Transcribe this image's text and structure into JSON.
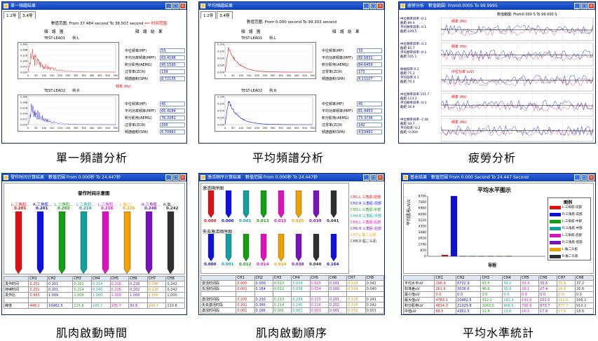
{
  "panels": [
    {
      "id": "single",
      "title": "單一頻譜結果",
      "tabs": [
        "1.2导",
        "3.4导"
      ],
      "range": "數值范圍: From 37.484 second To 38.507 second",
      "range_note": "时间范围",
      "header_left": "頻　譜　圖",
      "header_right": "頻　譜　結　果",
      "plot1_title": "TEST-LEAD1　　例:L",
      "plot2_title": "TEST-LEAD2　　例:R",
      "axis_label": "頻率 (Hz)",
      "y1_ticks": [
        "0.360",
        "0.288",
        "0.216",
        "0.144",
        "0.072",
        "0.000"
      ],
      "y2_ticks": [
        "0.360",
        "0.288",
        "0.216",
        "0.144",
        "0.072",
        "0.000"
      ],
      "x_ticks": [
        "0",
        "50",
        "100",
        "150",
        "200",
        "250",
        "300",
        "350",
        "400",
        "450",
        "500",
        "550"
      ],
      "params1": [
        {
          "label": "中位频率(MF)",
          "value": "53"
        },
        {
          "label": "平均功率頻率(MPF)",
          "value": "63.4196"
        },
        {
          "label": "积分肌电(AEMG)",
          "value": "95.1590"
        },
        {
          "label": "过零率(ZCR)",
          "value": "139"
        },
        {
          "label": "頻譜面积(SPA)",
          "value": "8.72135"
        }
      ],
      "params2": [
        {
          "label": "中位频率(MF)",
          "value": "45"
        },
        {
          "label": "平均功率頻率(MPF)",
          "value": "65.4184"
        },
        {
          "label": "积分肌电(AEMG)",
          "value": "76.2081"
        },
        {
          "label": "过零率(ZCR)",
          "value": "166"
        },
        {
          "label": "頻譜面积(SPA)",
          "value": "6.70991"
        }
      ],
      "caption": "單一頻譜分析"
    },
    {
      "id": "average",
      "title": "平均頻譜結果",
      "tabs": [
        "1.2导",
        "3.4导"
      ],
      "range": "數值范圍: From 0.000 second To 99.303 second",
      "header_left": "頻　譜　圖",
      "header_right": "頻　譜　結　果",
      "plot1_title": "TEST-LEAD1　　例:L",
      "plot2_title": "TEST-LEAD2　　例:R",
      "y1_ticks": [
        "0.140",
        "0.105",
        "0.070",
        "0.035",
        "0.000"
      ],
      "y2_ticks": [
        "0.140",
        "0.105",
        "0.070",
        "0.035",
        "0.000"
      ],
      "x_ticks": [
        "0",
        "50",
        "100",
        "150",
        "200",
        "250",
        "300",
        "350",
        "400",
        "450",
        "500",
        "550"
      ],
      "params1": [
        {
          "label": "中位频率(MF)",
          "value": "33"
        },
        {
          "label": "平均功率頻率(MPF)",
          "value": "82.5831"
        },
        {
          "label": "积分肌电(AEMG)",
          "value": "84.6459"
        },
        {
          "label": "过零率(ZCR)",
          "value": "173"
        },
        {
          "label": "頻譜面积(SPA)",
          "value": "8.11107"
        }
      ],
      "params2": [
        {
          "label": "中位频率(MF)",
          "value": "45"
        },
        {
          "label": "平均功率頻率(MPF)",
          "value": "81.4453"
        },
        {
          "label": "积分肌电(AEMG)",
          "value": "73.3736"
        },
        {
          "label": "过零率(ZCR)",
          "value": "142"
        },
        {
          "label": "頻譜面积(SPA)",
          "value": "4.53491"
        }
      ],
      "caption": "平均頻譜分析"
    },
    {
      "id": "fatigue",
      "title": "疲勞分析",
      "range": "數值範圍: From0.0005 To 99.9995",
      "range2": "數值範圍: From0.000 S To 99.000 S",
      "rows": [
        {
          "name": "頻率 (Hz)",
          "stats": [
            "中位頻率斜率:-0.2",
            "截距:89.4",
            "平均頻率斜率:-0.1",
            "截距:109.5"
          ]
        },
        {
          "name": "頻率 (Hz)",
          "stats": [
            "中位頻率斜率:-0.3",
            "截距:85.7",
            "平均頻率斜率:-0.2",
            "截距:105.1"
          ]
        },
        {
          "name": "中位功率 (uV)",
          "stats": [
            "振幅斜率:0.2",
            "截距:75.3",
            "平均斜率:0.1",
            "截距:70.3"
          ]
        },
        {
          "name": "頻率 (Hz)",
          "stats": [
            "中位頻率斜率:151.7",
            "截距:113.3",
            "平均頻率斜率:-0.3",
            "截距:36.9"
          ]
        },
        {
          "name": "頻率 (Hz)",
          "stats": [
            "中位頻率斜率:-7.46",
            "截距:40.7",
            "平均斜率:-0.2",
            "截距:-0.004"
          ]
        }
      ],
      "caption": "疲勞分析"
    },
    {
      "id": "onset",
      "title": "發作时间计算結果　數值范围 From 0.000秒 To 24.447秒",
      "chart_title": "發作时间示意图",
      "channels": [
        {
          "name": "L:三角肌...",
          "value": "0.201",
          "color": "#e01010"
        },
        {
          "name": "R:三角肌...",
          "value": "0.201",
          "color": "#1010e0"
        },
        {
          "name": "L:三角肌...",
          "value": "0.202",
          "color": "#10a010"
        },
        {
          "name": "L:三角肌...",
          "value": "0.214",
          "color": "#10a0a0"
        },
        {
          "name": "L:三角肌...",
          "value": "0.216",
          "color": "#e010c0"
        },
        {
          "name": "L:肱二...",
          "value": "0.226",
          "color": "#f0a000"
        },
        {
          "name": "R:三角肌...",
          "value": "0.240",
          "color": "#7a10c0"
        },
        {
          "name": "R:肱...",
          "value": "0.242",
          "color": "#303030"
        }
      ],
      "table_headers": [
        "",
        "CH1",
        "CH2",
        "CH3",
        "CH4",
        "CH5",
        "CH6",
        "CH7",
        "CH8"
      ],
      "table_rows": [
        [
          "发作时间",
          "0.201",
          "0.201",
          "0.202",
          "0.214",
          "0.216",
          "0.226",
          "0.240",
          "0.242"
        ],
        [
          "持续时间",
          "0.201",
          "0.201",
          "0.214",
          "0.240",
          "0.216",
          "0.202",
          "0.226",
          "0.242"
        ],
        [
          "发作比",
          "0.993",
          "1.000",
          "1.000",
          "1.000",
          "1.000",
          "1.000",
          "1.000",
          "1.000"
        ],
        [
          "",
          "",
          " ",
          " ",
          " ",
          " ",
          " ",
          " ",
          " "
        ],
        [
          "峰值",
          "448.1",
          "10462.5",
          "115.8",
          "105.7",
          "105.7",
          "90.6",
          "100.7",
          "110.8"
        ]
      ],
      "caption": "肌肉啟動時間"
    },
    {
      "id": "order",
      "title": "激活顺序计算結果　數值范围 From 0.000秒 To 24.447秒",
      "section1": "激活顺序图",
      "section2": "失去激活顺序图",
      "row1_values": [
        "0.000",
        "0.000",
        "0.001",
        "0.013",
        "0.015",
        "0.025",
        "0.039",
        "0.041"
      ],
      "row1_colors": [
        "#e01010",
        "#1010e0",
        "#10a0a0",
        "#10a010",
        "#e010c0",
        "#f0a000",
        "#7a10c0",
        "#303030"
      ],
      "row2_values": [
        "0.000",
        "0.001",
        "0.012",
        "0.014",
        "0.024",
        "0.038",
        "0.040",
        "0.164"
      ],
      "row2_colors": [
        "#1010e0",
        "#10a0a0",
        "#10a010",
        "#e010c0",
        "#f0a000",
        "#7a10c0",
        "#303030",
        "#1010e0"
      ],
      "legend": [
        {
          "text": "CH1:L 三角肌-前部",
          "color": "#e01010"
        },
        {
          "text": "CH2:R 三角肌-前部",
          "color": "#1010e0"
        },
        {
          "text": "CH3:L 三角肌-中部",
          "color": "#10a010"
        },
        {
          "text": "CH4:R 三角肌-中部",
          "color": "#10a0a0"
        },
        {
          "text": "CH5:L 三角肌-后部",
          "color": "#e010c0"
        },
        {
          "text": "CH6:R 三角肌-后部",
          "color": "#7a10c0"
        },
        {
          "text": "CH7:L 肱二头肌",
          "color": "#f0a000"
        },
        {
          "text": "CH8:R 肱二头肌",
          "color": "#303030"
        }
      ],
      "table_headers": [
        "",
        "CH1",
        "CH2",
        "CH3",
        "CH4",
        "CH5",
        "CH6",
        "CH7",
        "CH8"
      ],
      "table_rows": [
        [
          "激活时间段",
          "0.000",
          "0.000",
          "0.013",
          "0.039",
          "0.015",
          "0.001",
          "0.025",
          "0.041"
        ],
        [
          "失活时间段",
          "0.001",
          "0.164",
          "0.012",
          "0.038",
          "0.014",
          "0.000",
          "0.024",
          "0.040"
        ],
        [
          "",
          "",
          " ",
          " ",
          " ",
          " ",
          " ",
          " ",
          " "
        ],
        [
          "激活时间段",
          "0.200",
          "0.200",
          "0.213",
          "0.239",
          "0.215",
          "0.201",
          "0.225",
          "0.241"
        ],
        [
          "失去激活时段",
          "0.201",
          "0.366",
          "0.214",
          "0.240",
          "0.216",
          "0.202",
          "0.226",
          "0.242"
        ],
        [
          "激活时间段",
          "0.001",
          "0.166",
          "0.001",
          "0.001",
          "0.001",
          "0.001",
          "0.001",
          "0.001"
        ]
      ],
      "caption": "肌肉啟動順序"
    },
    {
      "id": "level",
      "title": "基本结果　數值范围 From 0.000 Second To 24.447 Second",
      "chart_title": "平均水平图示",
      "ylabel": "平均肌电uV/s",
      "xlabel": "导程",
      "y_ticks": [
        "8700",
        "7560",
        "6960",
        "6090",
        "5220",
        "4350",
        "3480",
        "2610",
        "1740",
        "870",
        "0"
      ],
      "legend_title": "图例",
      "legend": [
        {
          "text": "L:三角肌-前部",
          "color": "#e01010"
        },
        {
          "text": "R:三角肌-前部",
          "color": "#1010e0"
        },
        {
          "text": "L:三角肌-中部",
          "color": "#10a010"
        },
        {
          "text": "R:三角肌-中部",
          "color": "#10a0a0"
        },
        {
          "text": "L:三角肌-后部",
          "color": "#e010c0"
        },
        {
          "text": "R:三角肌-后部",
          "color": "#7a10c0"
        },
        {
          "text": "L:肱二头肌",
          "color": "#f0a000"
        },
        {
          "text": "R:肱二头肌",
          "color": "#303030"
        }
      ],
      "table_headers": [
        "",
        "CH1",
        "CH2",
        "CH3",
        "CH4",
        "CH5",
        "CH6",
        "CH7",
        "CH8"
      ],
      "table_rows": [
        [
          "平均水平uV",
          "196.9",
          "8722.9",
          "43.5",
          "39.2",
          "32.4",
          "35.6",
          "35.9",
          "37.2"
        ],
        [
          "标准差uV",
          "261.6",
          "3036.6",
          "46.6",
          "30.6",
          "26.1",
          "27.4",
          "26.8",
          "26.6"
        ],
        [
          "最小值uV",
          "0.0",
          "0.0",
          "0.0",
          "0.0",
          "0.0",
          "0.0",
          "0.0",
          "0.0"
        ],
        [
          "最大值uV",
          "4783.1",
          "10462.5",
          "312.2",
          "191.3",
          "141.0",
          "151.0",
          "151.0",
          "166.2"
        ],
        [
          "积分肌电uV",
          "4814.3",
          "21325.8",
          "1063.5",
          "958.5",
          "790.9",
          "870.7",
          "877.7",
          "910.2"
        ],
        [
          "中值uV",
          "88.5",
          "4361.5",
          "21.8",
          "19.6",
          "16.2",
          "17.8",
          "17.9",
          "18.6"
        ]
      ],
      "caption": "平均水準統計"
    }
  ],
  "level_chart_data": {
    "type": "bar",
    "categories": [
      "CH1",
      "CH2",
      "CH3",
      "CH4",
      "CH5",
      "CH6",
      "CH7",
      "CH8"
    ],
    "values": [
      196.9,
      8722.9,
      43.5,
      39.2,
      32.4,
      35.6,
      35.9,
      37.2
    ],
    "ylim": [
      0,
      8700
    ]
  }
}
